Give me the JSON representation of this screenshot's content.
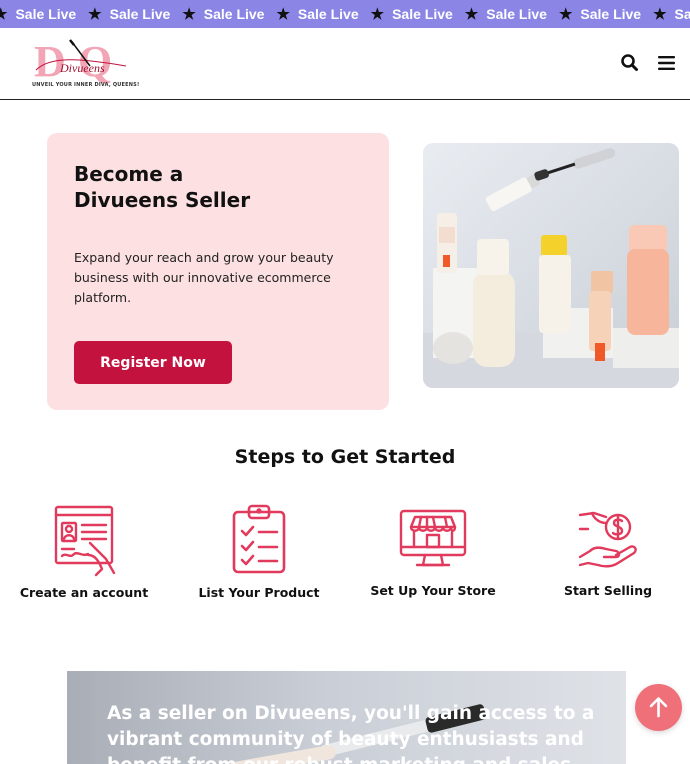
{
  "ticker": {
    "items": [
      "Sale Live",
      "Sale Live",
      "Sale Live",
      "Sale Live",
      "Sale Live",
      "Sale Live",
      "Sale Live",
      "Sale Live",
      "Sale Live"
    ]
  },
  "header": {
    "logo_text": "Divueens",
    "logo_tagline": "UNVEIL YOUR INNER DIVA, QUEENS!",
    "search_icon": "search-icon",
    "menu_icon": "hamburger-menu-icon"
  },
  "hero": {
    "title_line1": "Become a",
    "title_line2": "Divueens Seller",
    "description": "Expand your reach and grow your beauty business with our innovative ecommerce platform.",
    "register_label": "Register Now",
    "image_icon": "beauty-products-photo"
  },
  "steps": {
    "title": "Steps to Get Started",
    "items": [
      {
        "label": "Create an account",
        "icon": "account-form-icon"
      },
      {
        "label": "List Your Product",
        "icon": "clipboard-checklist-icon"
      },
      {
        "label": "Set Up Your Store",
        "icon": "storefront-monitor-icon"
      },
      {
        "label": "Start Selling",
        "icon": "hand-coin-icon"
      }
    ]
  },
  "banner": {
    "text": "As a seller on Divueens, you'll gain access to a vibrant community of beauty enthusiasts and benefit from our robust marketing and sales"
  },
  "colors": {
    "ticker_bg": "#8b86e6",
    "hero_bg": "#fde0e2",
    "accent": "#c2123d",
    "icon_pink": "#e23a5c",
    "scroll_top_bg": "#f0707a"
  }
}
